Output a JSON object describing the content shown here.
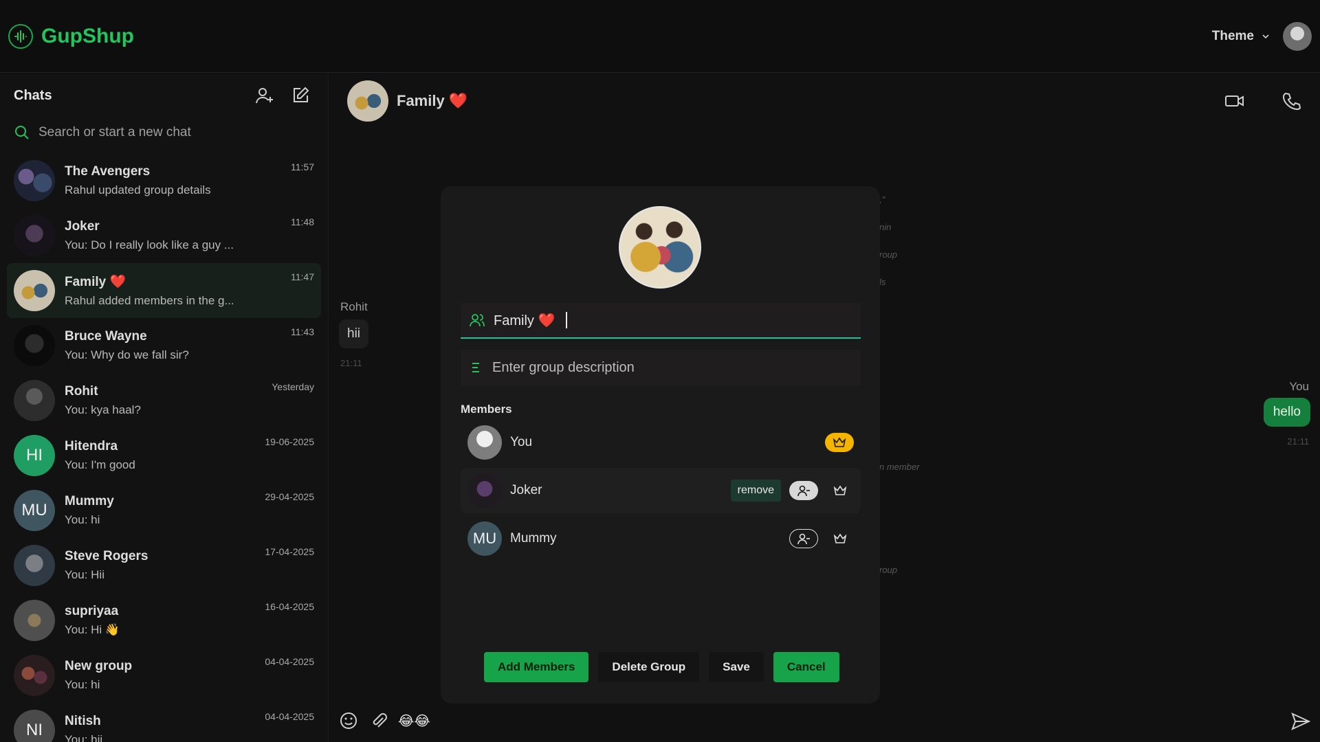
{
  "app": {
    "name": "GupShup",
    "theme_label": "Theme"
  },
  "sidebar": {
    "title": "Chats",
    "search_placeholder": "Search or start a new chat",
    "chats": [
      {
        "name": "The Avengers",
        "last": "Rahul updated group details",
        "time": "11:57",
        "avatar": "image"
      },
      {
        "name": "Joker",
        "last": "You: Do I really look like a guy ...",
        "time": "11:48",
        "avatar": "image"
      },
      {
        "name": "Family ❤️",
        "last": "Rahul added members in the g...",
        "time": "11:47",
        "avatar": "image",
        "active": true
      },
      {
        "name": "Bruce Wayne",
        "last": "You: Why do we fall sir?",
        "time": "11:43",
        "avatar": "image"
      },
      {
        "name": "Rohit",
        "last": "You: kya haal?",
        "time": "Yesterday",
        "avatar": "image"
      },
      {
        "name": "Hitendra",
        "last": "You: I'm good",
        "time": "19-06-2025",
        "avatar": "HI"
      },
      {
        "name": "Mummy",
        "last": "You: hi",
        "time": "29-04-2025",
        "avatar": "MU"
      },
      {
        "name": "Steve Rogers",
        "last": "You: Hii",
        "time": "17-04-2025",
        "avatar": "image"
      },
      {
        "name": "supriyaa",
        "last": "You: Hi 👋",
        "time": "16-04-2025",
        "avatar": "image"
      },
      {
        "name": "New group",
        "last": "You: hi",
        "time": "04-04-2025",
        "avatar": "image"
      },
      {
        "name": "Nitish",
        "last": "You: hii",
        "time": "04-04-2025",
        "avatar": "NI"
      }
    ]
  },
  "chat": {
    "title": "Family ❤️",
    "messages": {
      "other_name": "Rohit",
      "other_text": "hii",
      "other_time": "21:11",
      "you_name": "You",
      "you_text": "hello",
      "you_time": "21:11"
    },
    "system_fragments": [
      ",\"",
      "nin",
      "roup",
      "ls",
      "n member",
      "roup"
    ],
    "composer_emojis": "😂😂"
  },
  "modal": {
    "group_name": "Family ❤️",
    "description_placeholder": "Enter group description",
    "members_title": "Members",
    "members": [
      {
        "name": "You",
        "avatar": "image",
        "admin": true
      },
      {
        "name": "Joker",
        "avatar": "image",
        "admin": false,
        "remove_label": "remove"
      },
      {
        "name": "Mummy",
        "avatar": "MU",
        "admin": false
      }
    ],
    "buttons": {
      "add": "Add Members",
      "delete": "Delete Group",
      "save": "Save",
      "cancel": "Cancel"
    }
  },
  "colors": {
    "brand": "#22c55e",
    "accent_button": "#16a34a",
    "outgoing_bubble": "#15803d",
    "admin_gold": "#f5b400"
  }
}
